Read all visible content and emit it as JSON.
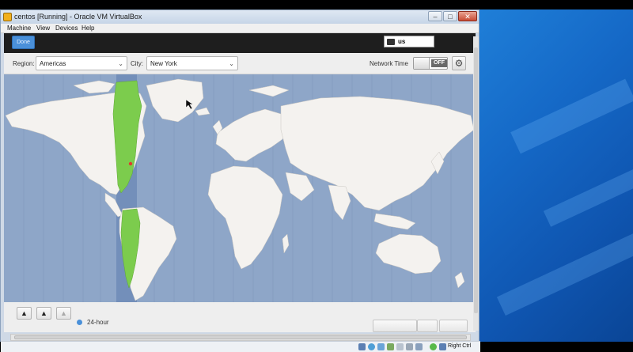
{
  "window": {
    "title": "centos [Running] - Oracle VM VirtualBox",
    "buttons": {
      "minimize": "–",
      "maximize": "□",
      "close": "✕"
    }
  },
  "menubar": {
    "items": [
      "Machine",
      "View",
      "Devices",
      "Help"
    ]
  },
  "guest": {
    "header": {
      "done_label": "Done",
      "keyboard_layout": "us"
    },
    "toolbar": {
      "region_label": "Region:",
      "region_value": "Americas",
      "city_label": "City:",
      "city_value": "New York",
      "network_time_label": "Network Time",
      "network_time_state": "OFF"
    },
    "map": {
      "highlighted_timezone": "America/New_York",
      "ocean_color": "#8ea6c8",
      "land_color": "#f4f2ef",
      "highlight_color": "#7ccc4d",
      "marker_color": "#e03a2f"
    },
    "bottom": {
      "time_format_label": "24-hour",
      "arrow_up": "▲"
    }
  },
  "statusbar": {
    "host_key": "Right Ctrl"
  },
  "colors": {
    "desktop": "#1569c7",
    "accent": "#4a90d9"
  }
}
